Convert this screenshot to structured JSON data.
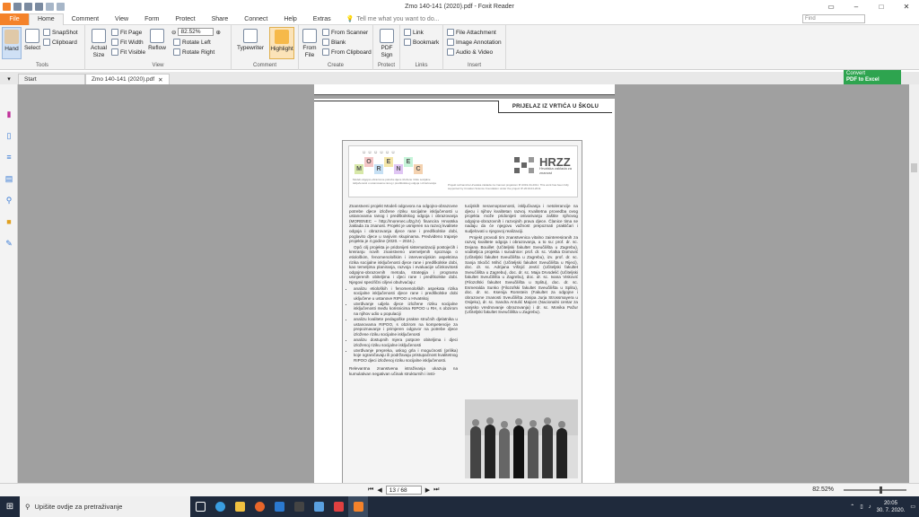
{
  "window": {
    "title": "Zmo 140-141 (2020).pdf - Foxit Reader"
  },
  "menu": {
    "file": "File",
    "tabs": [
      "Home",
      "Comment",
      "View",
      "Form",
      "Protect",
      "Share",
      "Connect",
      "Help",
      "Extras"
    ],
    "tell_me": "Tell me what you want to do...",
    "find": "Find"
  },
  "ribbon": {
    "hand": "Hand",
    "select": "Select",
    "snapshot": "SnapShot",
    "clipboard": "Clipboard",
    "tools_label": "Tools",
    "actual_size": "Actual Size",
    "fit_page": "Fit Page",
    "fit_width": "Fit Width",
    "fit_visible": "Fit Visible",
    "reflow": "Reflow",
    "zoom": "82.52%",
    "rotate_left": "Rotate Left",
    "rotate_right": "Rotate Right",
    "view_label": "View",
    "typewriter": "Typewriter",
    "highlight": "Highlight",
    "comment_label": "Comment",
    "from_file": "From File",
    "from_scanner": "From Scanner",
    "blank": "Blank",
    "from_clipboard": "From Clipboard",
    "create_label": "Create",
    "pdf_sign": "PDF Sign",
    "protect_label": "Protect",
    "link": "Link",
    "bookmark": "Bookmark",
    "links_label": "Links",
    "file_attachment": "File Attachment",
    "image_annotation": "Image Annotation",
    "audio_video": "Audio & Video",
    "insert_label": "Insert"
  },
  "convert": {
    "line1": "Convert",
    "line2": "PDF to Excel"
  },
  "doctabs": {
    "start": "Start",
    "doc": "Zmo 140-141 (2020).pdf"
  },
  "page": {
    "header": "PRIJELAZ IZ VRTIĆA U ŠKOLU",
    "logo_letters": [
      "M",
      "O",
      "R",
      "E",
      "N",
      "E",
      "C"
    ],
    "logo_caption": "Modeli odgojno-obrazovne potrebe djece izložene riziku socijalne isključenosti u ustanovama ranog i predškolskog odgoja i obrazovanja",
    "hrzz_name": "HRZZ",
    "hrzz_sub": "Hrvatska zaklada za znanost",
    "banner_note": "Projekt sufinancira Hrvatska zaklada za znanost projektom IP-2019-04-2011. This work has been fully supported by Croatian Science Foundation under the project IP-2019-04-2011.",
    "col1_intro": "Znanstveni projekt Modeli odgovora na odgojno-obrazovne potrebe djece izložene riziku socijalne isključenosti u ustanovama ranog i predškolskog odgoja i obrazovanja (MORENEC – http://morenec.ufzg.hr) financira Hrvatska zaklada za znanost. Projekt je usmjeren na razvoj kvalitete odgoja i obrazovanja djece rane i predškolske dobi, poglavito djece u ranjivim skupinama. Predviđeno trajanje projekta je 4 godine (2020. – 2024.).",
    "col1_p2": "Opći cilj projekta je pridonijeti sistematizaciji postojećih i kreiranju novih znanstveno utemeljenih spoznaja o etiološkim, fenomenološkim i intervencijskim aspektima rizika socijalne isključenosti djece rane i predškolske dobi, kao temeljima planiranja, razvoja i evaluacije učinkovitosti odgojno-obrazovnih metoda, strategija i programa usmjerenih obiteljima i djeci rane i predškolske dobi. Njegovi specifični ciljevi obuhvaćaju:",
    "col1_bullets": [
      "analizu etioloških i fenomenoloških aspekata rizika socijalne isključenosti djece rane i predškolske dobi uključene u ustanove RIPOO u Hrvatskoj",
      "utvrđivanje udjela djece izložene riziku socijalne isključenosti među korisnicima RIPOO u RH, s obzirom na njihov udio u populaciji",
      "analizu kvalitete pedagoške prakse stručnih djelatnika u ustanovama RIPOO, s obzirom na kompetencije za prepoznavanje i primjeren odgovor na potrebe djece izložene riziku socijalne isključenosti",
      "analizu dostupnih mjera potpore obiteljima i djeci izloženoj riziku socijalne isključenosti",
      "utvrđivanje prepreka, uskog grla i mogućnosti (prilika) koje ograničavaju ili podržavaju pristupačnost kvalitetnog RIPOO djeci izloženoj riziku socijalne isključenosti."
    ],
    "col1_end": "Relevantna znanstvena istraživanja ukazuju na kumulativan negativan učinak strukturnih i insti-",
    "col2_p1": "tucijskih neravnopravnosti, isključivanja i netolerancije na djecu i njihov kvalitetan razvoj. Kvalitetna provedba ovog projekta može pridonijeti ostvarivanju zaštite njihovog odgojno-obrazovnih i razvojnih prava djece. Članice tima se nadaju da će njegovu važnost prepoznati praktičari i sudjelovati u njegovoj realizaciji.",
    "col2_p2": "Projekt provodi tim znanstvenica vitalno zainteresiranih za razvoj kvalitete odgoja i obrazovanja, a to su: prof. dr. sc. Dejana Bouillet (Učiteljski fakultet Sveučilišta u Zagrebu), voditeljica projekta i suradnice: prof. dr. sc. Vlatka Domović (Učiteljski fakultet Sveučilišta u Zagrebu), izv. prof. dr. sc. Sanja Skočić Mihić (Učiteljski fakultet Sveučilišta u Rijeci), doc. dr. sc. Adrijana Višnjić Jevtić (Učiteljski fakultet Sveučilišta u Zagrebu), doc. dr. sc. Maja Drvodelić (Učiteljski fakultet Sveučilišta u Zagrebu), doc. dr. sc. Ivana Visković (Filozofski fakultet Sveučilišta u Splitu), doc. dr. sc. Esmeralda Sunko (Filozofski fakultet Sveučilišta u Splitu), doc. dr. sc. Ksenija Romstein (Fakultet za odgojne i obrazovne znanosti Sveučilišta Josipa Jurja Strossmayera u Osijeku), dr. sc. Sandra Antulić Majcen (Nacionalni centar za vanjsko vrednovanje obrazovanja) i dr. sc. Monika Pažur (Učiteljski fakultet Sveučilišta u Zagrebu)."
  },
  "status": {
    "page": "13 / 68",
    "zoom": "82.52%"
  },
  "taskbar": {
    "search": "Upišite ovdje za pretraživanje",
    "time": "20:05",
    "date": "30. 7. 2020."
  }
}
